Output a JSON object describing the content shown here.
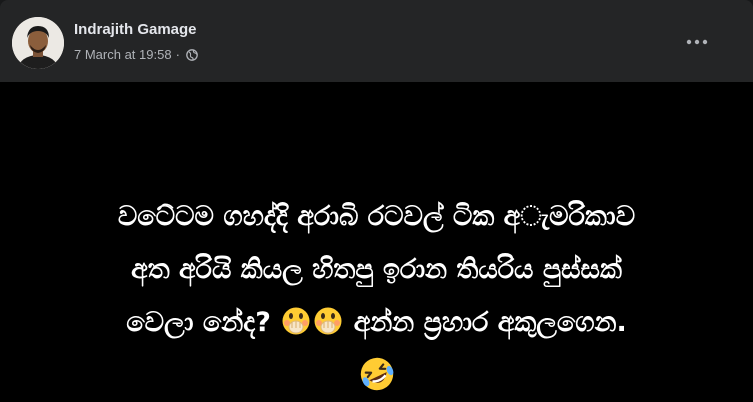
{
  "post": {
    "author": "Indrajith Gamage",
    "timestamp": "7 March at 19:58",
    "separator": "·",
    "audience_icon": "globe-icon",
    "more_icon": "more-options-icon"
  },
  "content": {
    "line1": "වටේටම ගහද්දි අරාබි රටවල් ටික අැමරිකාව",
    "line2": "අත අරියි කියල හිතපු ඉරාන තියරිය පුස්සක්",
    "line3_text": "වෙලා නේද?",
    "line3_emojis": [
      "face-with-hand-over-mouth-icon",
      "face-with-hand-over-mouth-icon"
    ],
    "line3_tail": "අන්න ප්‍රහාර අකුලගෙන.",
    "line4_emoji": "rolling-on-floor-laughing-icon"
  },
  "colors": {
    "card_bg": "#242526",
    "canvas_bg": "#000000",
    "author_text": "#e4e6eb",
    "meta_text": "#b0b3b8",
    "post_text": "#ffffff"
  }
}
